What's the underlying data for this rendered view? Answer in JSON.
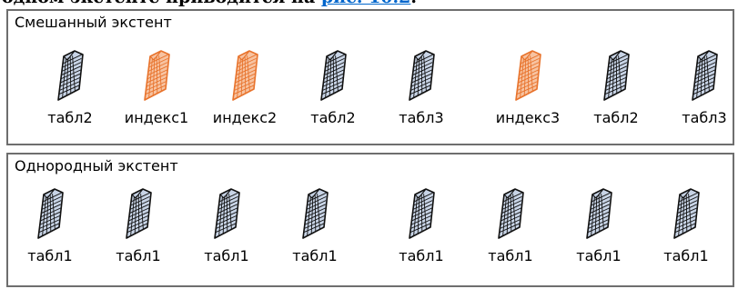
{
  "header": {
    "text_fragment": "одном экстенте приводится на ",
    "link_text": "рис. 10.2"
  },
  "colors": {
    "table_page_stroke": "#111111",
    "table_page_fill": "#c8d4e6",
    "index_page_stroke": "#e8732c",
    "index_page_fill": "#f7c3a1"
  },
  "mixed_extent": {
    "title": "Смешанный экстент",
    "pages": [
      {
        "label": "табл2",
        "kind": "table",
        "icon": "table-page-icon"
      },
      {
        "label": "индекс1",
        "kind": "index",
        "icon": "index-page-icon"
      },
      {
        "label": "индекс2",
        "kind": "index",
        "icon": "index-page-icon"
      },
      {
        "label": "табл2",
        "kind": "table",
        "icon": "table-page-icon"
      },
      {
        "label": "табл3",
        "kind": "table",
        "icon": "table-page-icon"
      },
      {
        "label": "индекс3",
        "kind": "index",
        "icon": "index-page-icon"
      },
      {
        "label": "табл2",
        "kind": "table",
        "icon": "table-page-icon"
      },
      {
        "label": "табл3",
        "kind": "table",
        "icon": "table-page-icon"
      }
    ]
  },
  "uniform_extent": {
    "title": "Однородный экстент",
    "pages": [
      {
        "label": "табл1",
        "kind": "table",
        "icon": "table-page-icon"
      },
      {
        "label": "табл1",
        "kind": "table",
        "icon": "table-page-icon"
      },
      {
        "label": "табл1",
        "kind": "table",
        "icon": "table-page-icon"
      },
      {
        "label": "табл1",
        "kind": "table",
        "icon": "table-page-icon"
      },
      {
        "label": "табл1",
        "kind": "table",
        "icon": "table-page-icon"
      },
      {
        "label": "табл1",
        "kind": "table",
        "icon": "table-page-icon"
      },
      {
        "label": "табл1",
        "kind": "table",
        "icon": "table-page-icon"
      },
      {
        "label": "табл1",
        "kind": "table",
        "icon": "table-page-icon"
      }
    ]
  }
}
